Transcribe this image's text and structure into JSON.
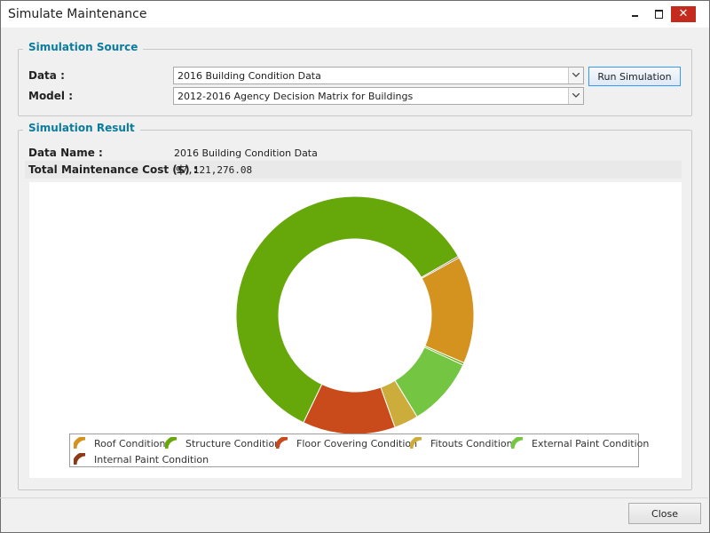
{
  "window": {
    "title": "Simulate Maintenance",
    "minimize_glyph": "—",
    "maximize_glyph": "☐",
    "close_glyph": "✕"
  },
  "source": {
    "group_title": "Simulation Source",
    "data_label": "Data :",
    "data_value": "2016 Building Condition Data",
    "model_label": "Model :",
    "model_value": "2012-2016 Agency Decision Matrix for Buildings",
    "run_label": "Run Simulation"
  },
  "result": {
    "group_title": "Simulation Result",
    "data_name_label": "Data Name :",
    "data_name_value": "2016 Building Condition Data",
    "cost_label": "Total Maintenance Cost ($) :",
    "cost_value": "97,121,276.08"
  },
  "chart_data": {
    "type": "pie",
    "donut": true,
    "title": "",
    "series": [
      {
        "name": "Roof Condition",
        "value": 14.6,
        "color": "#d4921f"
      },
      {
        "name": "Structure Condition",
        "value": 0.3,
        "color": "#66a80a"
      },
      {
        "name": "External Paint Condition",
        "value": 9.4,
        "color": "#74c642"
      },
      {
        "name": "Fitouts Condition",
        "value": 3.3,
        "color": "#ccad3c"
      },
      {
        "name": "Floor Covering Condition",
        "value": 12.6,
        "color": "#c94b1b"
      },
      {
        "name": "Structure Condition",
        "value": 59.6,
        "color": "#66a80a"
      },
      {
        "name": "Internal Paint Condition",
        "value": 0.2,
        "color": "#8e3a17"
      }
    ],
    "legend": {
      "placement": "bottom",
      "items": [
        {
          "name": "Roof Condition",
          "color": "#d4921f"
        },
        {
          "name": "Structure Condition",
          "color": "#66a80a"
        },
        {
          "name": "Floor Covering Condition",
          "color": "#c94b1b"
        },
        {
          "name": "Fitouts Condition",
          "color": "#ccad3c"
        },
        {
          "name": "External Paint Condition",
          "color": "#74c642"
        },
        {
          "name": "Internal Paint Condition",
          "color": "#8e3a17"
        }
      ]
    }
  },
  "footer": {
    "close_label": "Close"
  }
}
